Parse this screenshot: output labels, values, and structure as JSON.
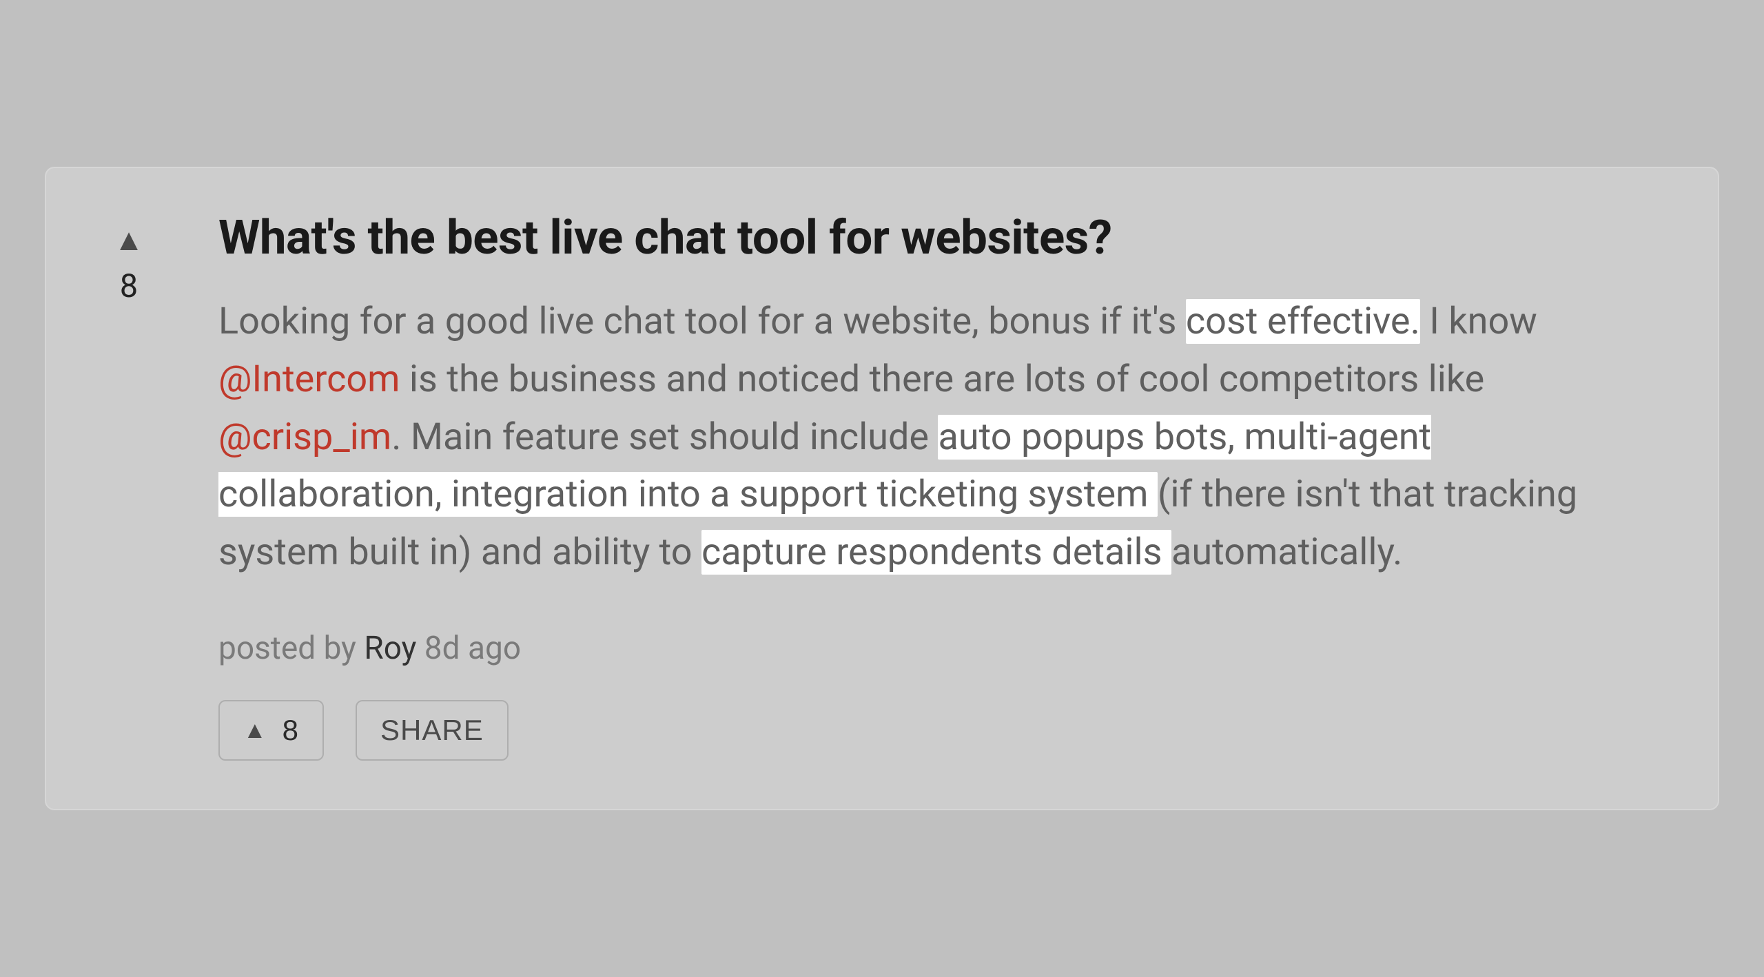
{
  "post": {
    "vote_count": "8",
    "title": "What's the best live chat tool for websites?",
    "body": {
      "seg1": "Looking for a good live chat tool for a website, bonus if it's ",
      "hl1": "cost effective.",
      "seg2": " I know ",
      "mention1": "@Intercom",
      "seg3": " is the business and noticed there are lots of cool competitors like ",
      "mention2": "@crisp_im",
      "seg4": ". Main feature set should include ",
      "hl2": "auto popups bots, multi-agent collaboration, integration into a support ticketing system ",
      "seg5": "(if there isn't that tracking system built in) and ability to ",
      "hl3": "capture respondents details ",
      "seg6": "automatically."
    },
    "meta": {
      "prefix": "posted by ",
      "author": "Roy",
      "time": " 8d ago"
    },
    "actions": {
      "upvote_count": "8",
      "share_label": "SHARE"
    }
  },
  "icons": {
    "upvote": "▲"
  }
}
